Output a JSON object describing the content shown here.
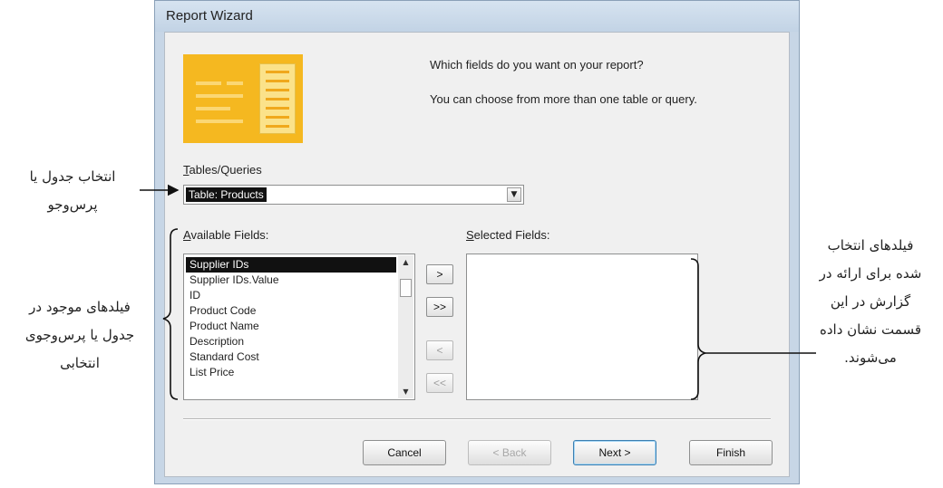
{
  "window": {
    "title": "Report Wizard"
  },
  "intro": {
    "question": "Which fields do you want on your report?",
    "hint": "You can choose from more than one table or query."
  },
  "tables_queries": {
    "label_underlined": "T",
    "label_rest": "ables/Queries",
    "selected_value": "Table: Products",
    "dropdown_icon": "chevron-down-icon"
  },
  "available_fields": {
    "label_underlined": "A",
    "label_rest": "vailable Fields:",
    "items": [
      "Supplier IDs",
      "Supplier IDs.Value",
      "ID",
      "Product Code",
      "Product Name",
      "Description",
      "Standard Cost",
      "List Price"
    ],
    "selected_index": 0
  },
  "selected_fields": {
    "label_underlined": "S",
    "label_rest": "elected Fields:",
    "items": []
  },
  "move_buttons": {
    "add_one": ">",
    "add_all": ">>",
    "remove_one": "<",
    "remove_all": "<<"
  },
  "footer_buttons": {
    "cancel": "Cancel",
    "back": "< Back",
    "next": "Next >",
    "finish": "Finish"
  },
  "annotations": {
    "tables_queries": [
      "انتخاب جدول یا",
      "پرس‌وجو"
    ],
    "available_fields": [
      "فیلدهای موجود در",
      "جدول یا پرس‌وجوی",
      "انتخابی"
    ],
    "selected_fields": [
      "فیلدهای انتخاب",
      "شده برای ارائه در",
      "گزارش در این",
      "قسمت نشان داده",
      "می‌شوند."
    ]
  }
}
